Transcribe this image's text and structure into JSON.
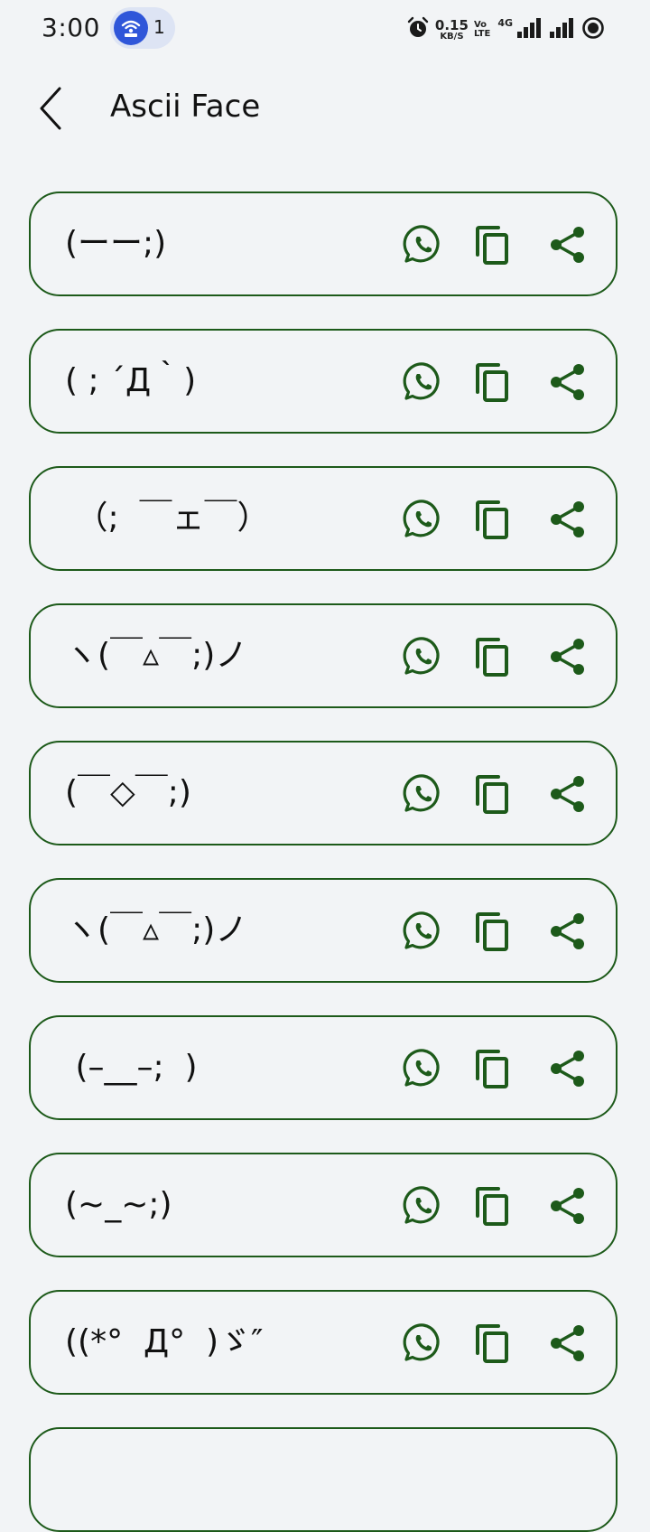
{
  "status_bar": {
    "time": "3:00",
    "hotspot_count": "1",
    "speed_value": "0.15",
    "speed_unit": "KB/S",
    "volte_top": "Vo",
    "volte_bottom": "LTE",
    "network": "4G",
    "icons": [
      "hotspot-icon",
      "alarm-icon",
      "signal-icon",
      "signal-icon",
      "battery-icon"
    ]
  },
  "header": {
    "title": "Ascii Face",
    "back_icon": "chevron-left-icon"
  },
  "faces": [
    "(ーー;)",
    "( ; ´Д｀)",
    " （;  ￣ェ￣）",
    "ヽ(￣▵￣;)ノ",
    "(￣◇￣;)",
    "ヽ(￣▵￣;)ノ",
    " (–__–;  )",
    "(~_~;)",
    "((*°  Д°  )ゞ″"
  ],
  "actions": {
    "whatsapp_icon": "whatsapp-icon",
    "copy_icon": "copy-icon",
    "share_icon": "share-icon"
  },
  "colors": {
    "accent": "#1d5a1a",
    "background": "#f2f4f6",
    "hotspot": "#2f56d9"
  }
}
